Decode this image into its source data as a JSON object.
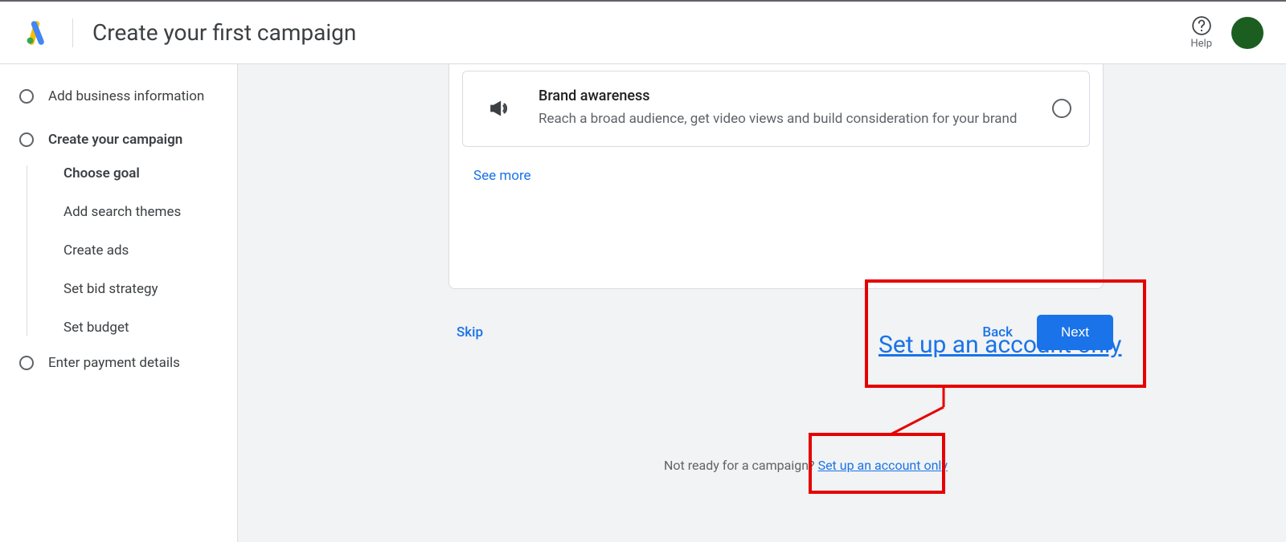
{
  "header": {
    "title": "Create your first campaign",
    "help_label": "Help"
  },
  "sidebar": {
    "step_business": "Add business information",
    "step_campaign": "Create your campaign",
    "sub_choose_goal": "Choose goal",
    "sub_search_themes": "Add search themes",
    "sub_create_ads": "Create ads",
    "sub_bid_strategy": "Set bid strategy",
    "sub_budget": "Set budget",
    "step_payment": "Enter payment details"
  },
  "goal": {
    "title": "Brand awareness",
    "description": "Reach a broad audience, get video views and build consideration for your brand"
  },
  "links": {
    "see_more": "See more",
    "skip": "Skip",
    "back": "Back",
    "next": "Next"
  },
  "footer": {
    "prompt": "Not ready for a campaign? ",
    "link": "Set up an account only"
  },
  "callout": {
    "text": "Set up an account only"
  }
}
